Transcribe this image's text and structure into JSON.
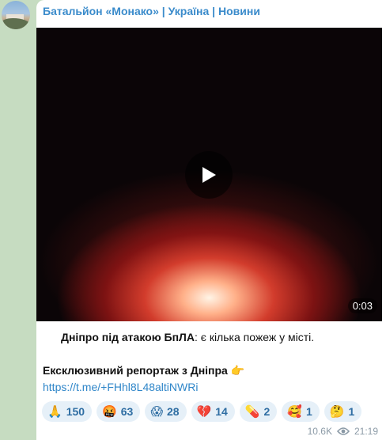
{
  "channel": {
    "name": "Батальйон «Монако» | Україна | Новини"
  },
  "video": {
    "duration": "0:03"
  },
  "message": {
    "bold_part": "Дніпро під атакою БпЛА",
    "regular_part": ": є кілька пожеж у місті.",
    "exclusive": "Ексклюзивний репортаж з Дніпра 👉",
    "link": "https://t.me/+FHhl8L48altiNWRi"
  },
  "reactions": [
    {
      "emoji": "🙏",
      "count": "150"
    },
    {
      "emoji": "🤬",
      "count": "63"
    },
    {
      "emoji": "😱",
      "count": "28"
    },
    {
      "emoji": "💔",
      "count": "14"
    },
    {
      "emoji": "💊",
      "count": "2"
    },
    {
      "emoji": "🥰",
      "count": "1"
    },
    {
      "emoji": "🤔",
      "count": "1"
    }
  ],
  "meta": {
    "views": "10.6K",
    "time": "21:19"
  },
  "icons": {
    "avatar": "channel-avatar",
    "play": "play-icon",
    "views": "eye-icon"
  }
}
